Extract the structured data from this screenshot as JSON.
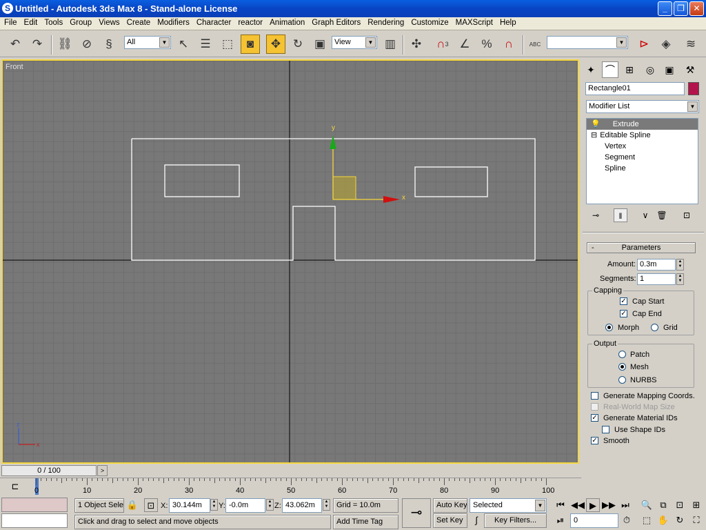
{
  "window": {
    "title": "Untitled - Autodesk 3ds Max 8  - Stand-alone License",
    "minimize": "_",
    "maximize": "❐",
    "close": "✕"
  },
  "menu": [
    "File",
    "Edit",
    "Tools",
    "Group",
    "Views",
    "Create",
    "Modifiers",
    "Character",
    "reactor",
    "Animation",
    "Graph Editors",
    "Rendering",
    "Customize",
    "MAXScript",
    "Help"
  ],
  "toolbar": {
    "selection_filter": "All",
    "ref_coord": "View",
    "named_selection": "",
    "icons": [
      "undo-icon",
      "redo-icon",
      "select-link-icon",
      "unlink-icon",
      "bind-spacewarp-icon",
      "select-object-icon",
      "select-by-name-icon",
      "rect-region-icon",
      "window-crossing-icon",
      "move-icon",
      "rotate-icon",
      "scale-icon",
      "pivot-icon",
      "manipulate-icon",
      "snap-3d-icon",
      "angle-snap-icon",
      "percent-snap-icon",
      "spinner-snap-icon",
      "edit-named-sel-icon",
      "mirror-icon",
      "align-icon",
      "layer-icon"
    ],
    "snap_label": "3",
    "percent_label": "%",
    "abc_label": "ABC"
  },
  "viewport": {
    "label": "Front",
    "gizmo_x": "x",
    "gizmo_y": "y",
    "axis_z": "z",
    "axis_x": "x"
  },
  "command_panel": {
    "object_name": "Rectangle01",
    "object_color": "#b4144c",
    "modifier_list": "Modifier List",
    "stack": [
      "Extrude",
      "Editable Spline",
      "Vertex",
      "Segment",
      "Spline"
    ],
    "stack_prefix": "⊟",
    "parameters_title": "Parameters",
    "amount_label": "Amount:",
    "amount_value": "0.3m",
    "segments_label": "Segments:",
    "segments_value": "1",
    "capping_title": "Capping",
    "cap_start": "Cap Start",
    "cap_end": "Cap End",
    "morph": "Morph",
    "grid": "Grid",
    "output_title": "Output",
    "patch": "Patch",
    "mesh": "Mesh",
    "nurbs": "NURBS",
    "gen_mapping": "Generate Mapping Coords.",
    "real_world": "Real-World Map Size",
    "gen_material": "Generate Material IDs",
    "use_shape": "Use Shape IDs",
    "smooth": "Smooth",
    "check_mark": "✓"
  },
  "timeline": {
    "frame_display": "0 / 100",
    "next": ">",
    "ticks": [
      "0",
      "10",
      "20",
      "30",
      "40",
      "50",
      "60",
      "70",
      "80",
      "90",
      "100"
    ]
  },
  "status": {
    "selection_count": "1 Object Sele",
    "x_label": "X:",
    "x_value": "30.144m",
    "y_label": "Y:",
    "y_value": "-0.0m",
    "z_label": "Z:",
    "z_value": "43.062m",
    "grid": "Grid = 10.0m",
    "add_time_tag": "Add Time Tag",
    "prompt": "Click and drag to select and move objects",
    "auto_key": "Auto Key",
    "set_key": "Set Key",
    "selected": "Selected",
    "key_filters": "Key Filters...",
    "frame": "0"
  }
}
